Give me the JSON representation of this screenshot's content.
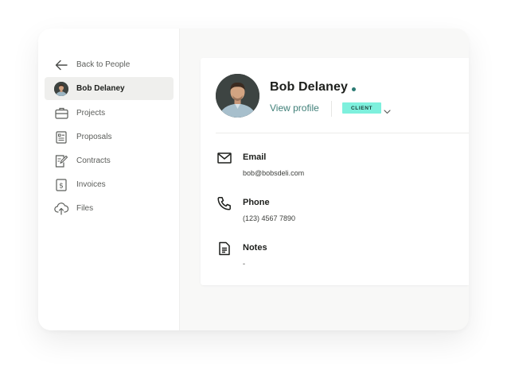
{
  "sidebar": {
    "back_label": "Back to People",
    "items": [
      {
        "label": "Bob Delaney",
        "icon": "avatar",
        "active": true
      },
      {
        "label": "Projects",
        "icon": "briefcase-icon"
      },
      {
        "label": "Proposals",
        "icon": "proposal-icon"
      },
      {
        "label": "Contracts",
        "icon": "contract-icon"
      },
      {
        "label": "Invoices",
        "icon": "invoice-icon"
      },
      {
        "label": "Files",
        "icon": "cloud-upload-icon"
      }
    ]
  },
  "profile": {
    "name": "Bob Delaney",
    "view_profile_label": "View profile",
    "badge": "CLIENT",
    "status_color": "#2b7a73"
  },
  "fields": [
    {
      "label": "Email",
      "value": "bob@bobsdeli.com",
      "icon": "mail-icon"
    },
    {
      "label": "Phone",
      "value": "(123) 4567 7890",
      "icon": "phone-icon"
    },
    {
      "label": "Notes",
      "value": "-",
      "icon": "notes-icon"
    }
  ],
  "colors": {
    "accent": "#3f7f78",
    "badge_bg": "#7ef0dd",
    "active_bg": "#efefed"
  }
}
